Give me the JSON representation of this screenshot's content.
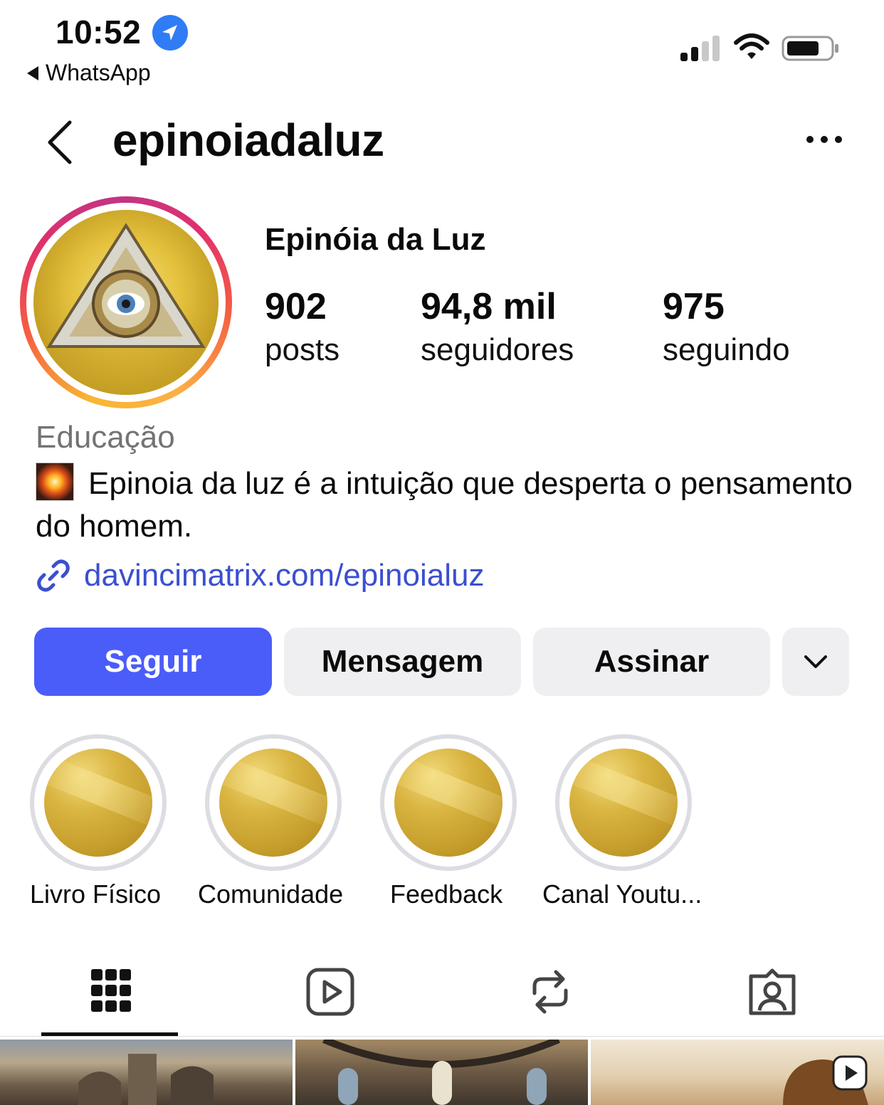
{
  "status_bar": {
    "time": "10:52",
    "back_app": "WhatsApp"
  },
  "header": {
    "username": "epinoiadaluz"
  },
  "profile": {
    "display_name": "Epinóia da Luz",
    "stats": [
      {
        "value": "902",
        "label": "posts"
      },
      {
        "value": "94,8 mil",
        "label": "seguidores"
      },
      {
        "value": "975",
        "label": "seguindo"
      }
    ],
    "category": "Educação",
    "bio": "Epinoia da luz é a intuição que desperta o pensamento do homem.",
    "link": "davincimatrix.com/epinoialuz"
  },
  "buttons": {
    "follow": "Seguir",
    "message": "Mensagem",
    "subscribe": "Assinar"
  },
  "highlights": [
    {
      "label": "Livro Físico"
    },
    {
      "label": "Comunidade"
    },
    {
      "label": "Feedback"
    },
    {
      "label": "Canal Youtu..."
    }
  ],
  "tabs": [
    {
      "icon": "grid-icon",
      "active": true
    },
    {
      "icon": "reels-icon",
      "active": false
    },
    {
      "icon": "reposts-icon",
      "active": false
    },
    {
      "icon": "tagged-icon",
      "active": false
    }
  ],
  "colors": {
    "accent": "#4a5df9",
    "link": "#3b4fd0",
    "secondary_text": "#737373",
    "button_grey": "#efeff2"
  }
}
